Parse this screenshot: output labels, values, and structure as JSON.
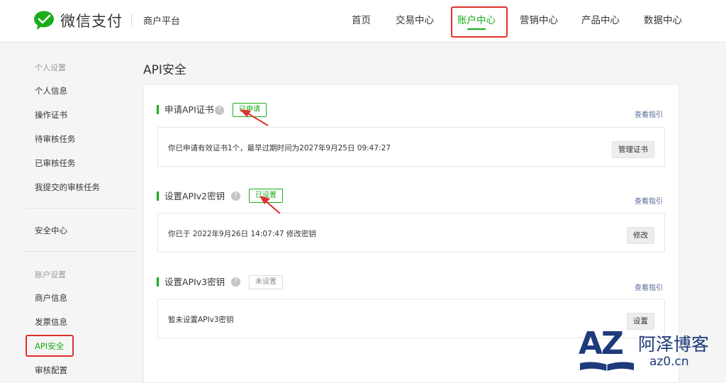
{
  "header": {
    "logo_text": "微信支付",
    "sub_title": "商户平台",
    "nav": [
      "首页",
      "交易中心",
      "账户中心",
      "营销中心",
      "产品中心",
      "数据中心"
    ],
    "active_nav": "账户中心"
  },
  "sidebar": {
    "group1": "个人设置",
    "items1": [
      "个人信息",
      "操作证书",
      "待审核任务",
      "已审核任务",
      "我提交的审核任务"
    ],
    "security": "安全中心",
    "group2": "账户设置",
    "items2": [
      "商户信息",
      "发票信息",
      "API安全",
      "审核配置"
    ],
    "active_item": "API安全"
  },
  "main": {
    "title": "API安全",
    "sections": [
      {
        "title": "申请API证书",
        "badge": "已申请",
        "guide": "查看指引",
        "info": "你已申请有效证书1个，最早过期时间为2027年9月25日 09:47:27",
        "button": "管理证书"
      },
      {
        "title": "设置APIv2密钥",
        "badge": "已设置",
        "guide": "查看指引",
        "info": "你已于 2022年9月26日 14:07:47 修改密钥",
        "button": "修改"
      },
      {
        "title": "设置APIv3密钥",
        "badge": "未设置",
        "guide": "查看指引",
        "info": "暂未设置APIv3密钥",
        "button": "设置"
      }
    ]
  },
  "watermark": {
    "logo_letters": "AZ",
    "name": "阿泽博客",
    "url": "az0.cn"
  },
  "colors": {
    "accent": "#1aad19",
    "highlight_box": "#e0302b",
    "link": "#576b95",
    "watermark": "#1e3a7a"
  }
}
